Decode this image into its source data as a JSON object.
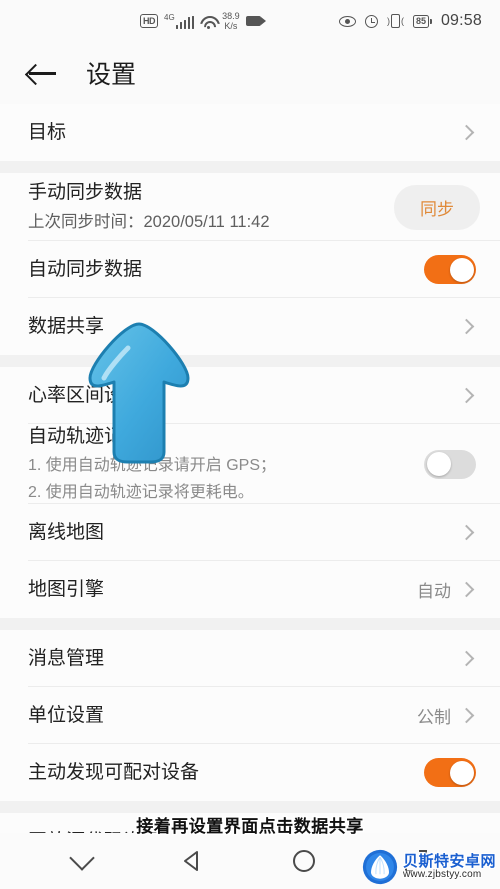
{
  "status_bar": {
    "hd_label": "HD",
    "network_type": "4G",
    "speed_value": "38.9",
    "speed_unit": "K/s",
    "battery_level": "85",
    "time": "09:58",
    "icons": [
      "hd-badge",
      "signal-bars-icon",
      "wifi-icon",
      "network-speed",
      "screen-recorder-icon",
      "eye-care-icon",
      "alarm-icon",
      "vibrate-icon",
      "battery-icon"
    ]
  },
  "header": {
    "back_icon": "back-arrow-icon",
    "title": "设置"
  },
  "list": {
    "goal": {
      "label": "目标"
    },
    "manual_sync": {
      "label": "手动同步数据",
      "sublabel": "上次同步时间：2020/05/11 11:42",
      "button": "同步"
    },
    "auto_sync": {
      "label": "自动同步数据",
      "toggle": "on"
    },
    "data_share": {
      "label": "数据共享"
    },
    "heart_rate": {
      "label": "心率区间设置"
    },
    "auto_track": {
      "label": "自动轨迹记录",
      "note1": "1. 使用自动轨迹记录请开启 GPS；",
      "note2": "2. 使用自动轨迹记录将更耗电。",
      "toggle": "off"
    },
    "offline_map": {
      "label": "离线地图"
    },
    "map_engine": {
      "label": "地图引擎",
      "value": "自动"
    },
    "message_mgmt": {
      "label": "消息管理"
    },
    "unit_setting": {
      "label": "单位设置",
      "value": "公制"
    },
    "discover_devices": {
      "label": "主动发现可配对设备",
      "toggle": "on"
    },
    "open_source": {
      "label": "开放源代码许可"
    }
  },
  "overlay": {
    "caption": "接着再设置界面点击数据共享",
    "cursor_icon": "pointer-arrow-cursor"
  },
  "watermark": {
    "name": "贝斯特安卓网",
    "url": "www.zjbstyy.com"
  },
  "navbar": {
    "items": [
      "chevron-down-icon",
      "back-triangle-icon",
      "home-circle-icon",
      "recents-square-icon"
    ]
  },
  "colors": {
    "accent": "#f26f15",
    "pill_text": "#e08a39",
    "cursor": "#3fa9dd",
    "watermark_blue": "#1a5fd0"
  }
}
